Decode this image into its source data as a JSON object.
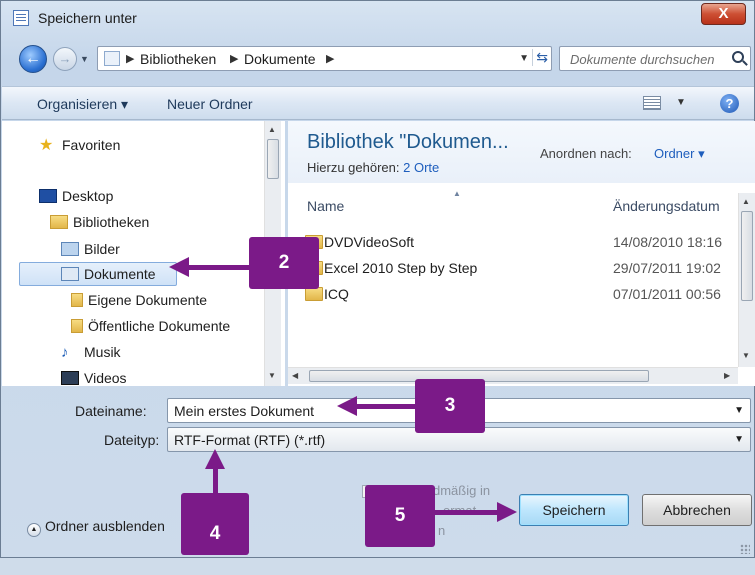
{
  "window": {
    "title": "Speichern unter",
    "close_label": "X"
  },
  "nav": {
    "back_label": "←",
    "forward_label": "→",
    "breadcrumbs": [
      "Bibliotheken",
      "Dokumente"
    ],
    "search_placeholder": "Dokumente durchsuchen"
  },
  "toolbar": {
    "organize_label": "Organisieren ▾",
    "new_folder_label": "Neuer Ordner",
    "help_label": "?"
  },
  "sidebar": {
    "items": [
      {
        "label": "Favoriten",
        "icon": "star-icon"
      },
      {
        "label": "Desktop",
        "icon": "desktop-icon"
      },
      {
        "label": "Bibliotheken",
        "icon": "library-icon"
      },
      {
        "label": "Bilder",
        "icon": "pictures-icon"
      },
      {
        "label": "Dokumente",
        "icon": "documents-icon",
        "selected": true
      },
      {
        "label": "Eigene Dokumente",
        "icon": "folder-icon"
      },
      {
        "label": "Öffentliche Dokumente",
        "icon": "folder-icon"
      },
      {
        "label": "Musik",
        "icon": "music-icon"
      },
      {
        "label": "Videos",
        "icon": "video-icon"
      }
    ]
  },
  "library": {
    "title": "Bibliothek \"Dokumen...",
    "subtitle_prefix": "Hierzu gehören:",
    "subtitle_link": "2 Orte",
    "arrange_label": "Anordnen nach:",
    "arrange_value": "Ordner ▾"
  },
  "file_list": {
    "columns": [
      "Name",
      "Änderungsdatum"
    ],
    "rows": [
      {
        "name": "DVDVideoSoft",
        "date": "14/08/2010 18:16"
      },
      {
        "name": "Excel 2010 Step by Step",
        "date": "29/07/2011 19:02"
      },
      {
        "name": "ICQ",
        "date": "07/01/2011 00:56"
      }
    ]
  },
  "form": {
    "filename_label": "Dateiname:",
    "filename_value": "Mein erstes Dokument",
    "filetype_label": "Dateityp:",
    "filetype_value": "RTF-Format (RTF) (*.rtf)",
    "faint_text_1": "dmäßig in",
    "faint_text_2": "ormat",
    "faint_text_3": "n"
  },
  "footer": {
    "hide_folders_label": "Ordner ausblenden",
    "save_label": "Speichern",
    "cancel_label": "Abbrechen"
  },
  "callouts": {
    "c2": "2",
    "c3": "3",
    "c4": "4",
    "c5": "5"
  },
  "colors": {
    "callout": "#7b1a88",
    "link": "#1e5ebd",
    "title_blue": "#1f5a8f"
  }
}
